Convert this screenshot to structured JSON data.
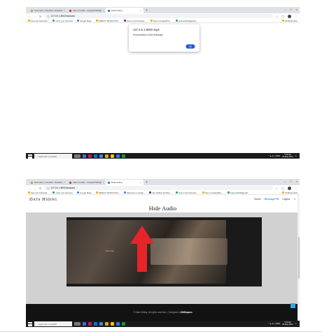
{
  "shot1": {
    "tabs": [
      {
        "label": "Summary | Overleaf - Readers",
        "active": false
      },
      {
        "label": "Inbox (1,041) - anupam6024@",
        "active": false
      },
      {
        "label": "Data Hiding",
        "active": true
      }
    ],
    "url": "127.0.0.1:8000/hostcard",
    "bookmarks": [
      "Story the Perfectbl...",
      "verify your business",
      "Google Maps",
      "OBJECT DETECTION...",
      "Welcome to Instagr...",
      "Top 10 Best Familiar...",
      "How to Find Dundee...",
      "How to Avatar&Pre...",
      "anamonth04@gmail..."
    ],
    "bookmarks_right": "All Bookmarks",
    "dialog": {
      "title": "127.0.0.1:8000 says",
      "message": "Successfully to Hide Massage",
      "ok_label": "OK"
    },
    "taskbar": {
      "search": "Type here to search",
      "time": "7:56 AM",
      "date": "06-May-2024"
    }
  },
  "shot2": {
    "tabs": [
      {
        "label": "Summary | Overleaf - Readers",
        "active": false
      },
      {
        "label": "Inbox (1,041) - anupam6024@",
        "active": false
      },
      {
        "label": "Data Hiding",
        "active": true
      }
    ],
    "url": "127.0.0.1:8000/hostcard",
    "bookmarks": [
      "Story the Perfectbl...",
      "verify your business",
      "Google Maps",
      "OBJECT DETECTION...",
      "Welcome to Instagr...",
      "Top 10 Best Familiar...",
      "How to Find Dundee...",
      "How to Avatar&Pre...",
      "anamonth04@gmail..."
    ],
    "bookmarks_right": "All Bookmarks",
    "site": {
      "brand": "Data Hiding",
      "nav": [
        "Home",
        "Message+Hi",
        "Logout"
      ],
      "heading": "Hide Audio",
      "media_caption": "Message",
      "footer_prefix": "© Data Hiding. All rights reserved. | Designed by ",
      "footer_author": "WdSupacs"
    },
    "taskbar": {
      "search": "Type here to search",
      "time": "7:56 AM",
      "date": "06-May-2024"
    }
  },
  "colors": {
    "accent": "#2e9bd8",
    "ok_button": "#1a57c9",
    "arrow": "#e8232a",
    "footer": "#121212"
  }
}
